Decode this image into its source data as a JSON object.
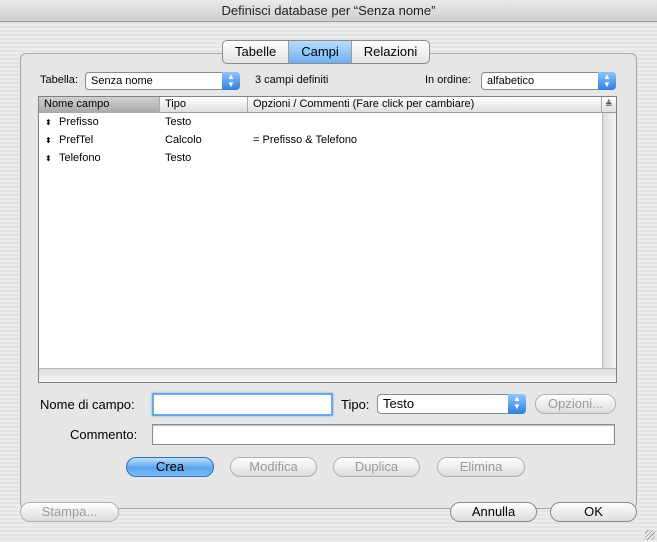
{
  "window": {
    "title": "Definisci database per “Senza nome”"
  },
  "tabs": [
    {
      "label": "Tabelle",
      "active": false
    },
    {
      "label": "Campi",
      "active": true
    },
    {
      "label": "Relazioni",
      "active": false
    }
  ],
  "table_selector": {
    "label": "Tabella:",
    "value": "Senza nome"
  },
  "field_count": "3 campi definiti",
  "sort": {
    "label": "In ordine:",
    "value": "alfabetico"
  },
  "fields_table": {
    "columns": [
      "Nome campo",
      "Tipo",
      "Opzioni / Commenti (Fare click per cambiare)"
    ],
    "rows": [
      {
        "name": "Prefisso",
        "type": "Testo",
        "options": ""
      },
      {
        "name": "PrefTel",
        "type": "Calcolo",
        "options": "= Prefisso & Telefono"
      },
      {
        "name": "Telefono",
        "type": "Testo",
        "options": ""
      }
    ]
  },
  "form": {
    "name_label": "Nome di campo:",
    "name_value": "",
    "type_label": "Tipo:",
    "type_value": "Testo",
    "options_button": "Opzioni...",
    "comment_label": "Commento:",
    "comment_value": ""
  },
  "actions": {
    "create": "Crea",
    "modify": "Modifica",
    "duplicate": "Duplica",
    "delete": "Elimina"
  },
  "footer": {
    "print": "Stampa...",
    "cancel": "Annulla",
    "ok": "OK"
  },
  "colors": {
    "accent": "#6fb1f0",
    "disabled_text": "#9a9a9a"
  }
}
